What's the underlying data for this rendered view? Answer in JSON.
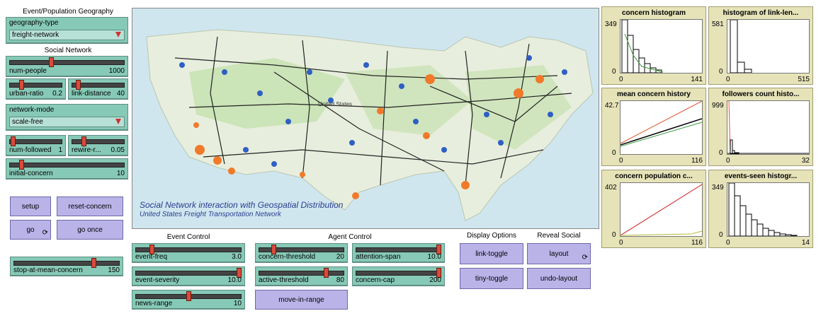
{
  "geography_section": {
    "title": "Event/Population Geography",
    "chooser_label": "geography-type",
    "chooser_value": "freight-network"
  },
  "social_section": {
    "title": "Social Network",
    "num_people": {
      "label": "num-people",
      "value": "1000",
      "fraction": 0.45
    },
    "urban_ratio": {
      "label": "urban-ratio",
      "value": "0.2",
      "fraction": 0.2
    },
    "link_distance": {
      "label": "link-distance",
      "value": "40",
      "fraction": 0.1
    },
    "network_mode": {
      "label": "network-mode",
      "value": "scale-free"
    },
    "num_followed": {
      "label": "num-followed",
      "value": "1",
      "fraction": 0.0
    },
    "rewire": {
      "label": "rewire-r...",
      "value": "0.05",
      "fraction": 0.05
    },
    "initial_concern": {
      "label": "initial-concern",
      "value": "10",
      "fraction": 0.1
    }
  },
  "buttons": {
    "setup": "setup",
    "reset_concern": "reset-concern",
    "go": "go",
    "go_once": "go once",
    "move_in_range": "move-in-range",
    "link_toggle": "link-toggle",
    "tiny_toggle": "tiny-toggle",
    "layout": "layout",
    "undo_layout": "undo-layout"
  },
  "stop_slider": {
    "label": "stop-at-mean-concern",
    "value": "150",
    "fraction": 0.75
  },
  "map": {
    "caption_title": "Social Network interaction with Geospatial Distribution",
    "caption_subtitle": "United States Freight Transportation Network",
    "label": "United States"
  },
  "event_control": {
    "title": "Event Control",
    "event_freq": {
      "label": "event-freq",
      "value": "3.0",
      "fraction": 0.15
    },
    "event_severity": {
      "label": "event-severity",
      "value": "10.0",
      "fraction": 1.0
    },
    "news_range": {
      "label": "news-range",
      "value": "10",
      "fraction": 0.5
    }
  },
  "agent_control": {
    "title": "Agent Control",
    "concern_threshold": {
      "label": "concern-threshold",
      "value": "20",
      "fraction": 0.1
    },
    "attention_span": {
      "label": "attention-span",
      "value": "10.0",
      "fraction": 1.0
    },
    "active_threshold": {
      "label": "active-threshold",
      "value": "80",
      "fraction": 0.75
    },
    "concern_cap": {
      "label": "concern-cap",
      "value": "200",
      "fraction": 1.0
    }
  },
  "display_options": {
    "title": "Display Options"
  },
  "reveal_social": {
    "title": "Reveal Social"
  },
  "plots": {
    "concern_histogram": {
      "title": "concern histogram",
      "ymax": "349",
      "ymin": "0",
      "xmin": "0",
      "xmax": "141"
    },
    "link_length": {
      "title": "histogram of link-len...",
      "ymax": "581",
      "ymin": "0",
      "xmin": "0",
      "xmax": "515"
    },
    "mean_concern": {
      "title": "mean concern history",
      "ymax": "42.7",
      "ymin": "0",
      "xmin": "0",
      "xmax": "116"
    },
    "followers_count": {
      "title": "followers count histo...",
      "ymax": "999",
      "ymin": "0",
      "xmin": "0",
      "xmax": "32"
    },
    "concern_population": {
      "title": "concern population c...",
      "ymax": "402",
      "ymin": "0",
      "xmin": "0",
      "xmax": "116"
    },
    "events_seen": {
      "title": "events-seen histogr...",
      "ymax": "349",
      "ymin": "0",
      "xmin": "0",
      "xmax": "14"
    }
  },
  "colors": {
    "slider": "#86c9b6",
    "button": "#b9b3e8",
    "plot": "#e6e3b9",
    "thumb": "#d94b3b"
  }
}
